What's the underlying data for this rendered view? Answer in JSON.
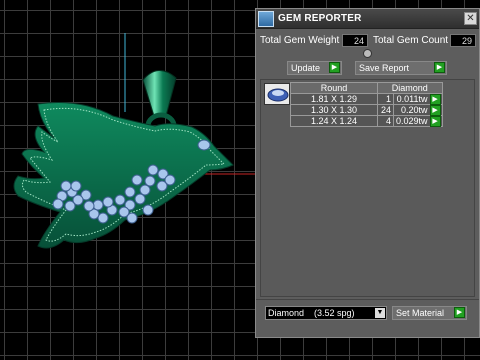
{
  "panel": {
    "title": "GEM REPORTER",
    "close_glyph": "✕",
    "total_weight_label": "Total Gem Weight",
    "total_weight_value": "24",
    "total_count_label": "Total Gem Count",
    "total_count_value": "29",
    "update_label": "Update",
    "save_report_label": "Save Report",
    "go_glyph": "▶"
  },
  "report": {
    "headers": [
      "Round",
      "Diamond"
    ],
    "rows": [
      {
        "size": "1.81 X 1.29",
        "count": "1",
        "weight": "0.011tw"
      },
      {
        "size": "1.30 X 1.30",
        "count": "24",
        "weight": "0.20tw"
      },
      {
        "size": "1.24 X 1.24",
        "count": "4",
        "weight": "0.029tw"
      }
    ]
  },
  "material": {
    "selected": "Diamond    (3.52 spg)",
    "set_label": "Set Material",
    "dropdown_glyph": "▼"
  },
  "colors": {
    "model_green": "#0a6b4a",
    "gem_blue": "#a8c6ec",
    "panel_bg": "#5d5d5d"
  }
}
